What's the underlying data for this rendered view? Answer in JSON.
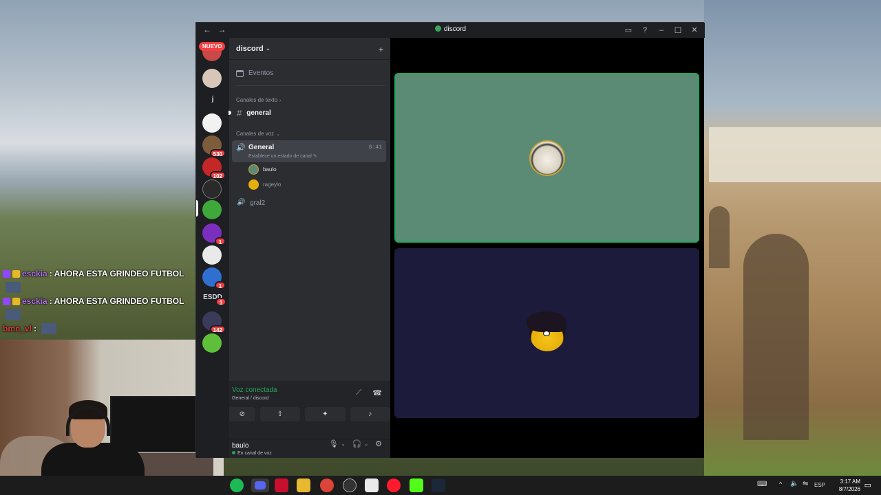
{
  "window": {
    "title": "discord",
    "nav_back": "←",
    "nav_forward": "→",
    "controls": {
      "inbox": "▭",
      "help": "?",
      "minimize": "–",
      "maximize": "☐",
      "close": "✕"
    }
  },
  "rail": {
    "nuevo_label": "NUEVO",
    "text_items": [
      {
        "label": "j"
      },
      {
        "label": "ESDD"
      }
    ],
    "badges": [
      "530",
      "102",
      "1",
      "1",
      "1",
      "142"
    ]
  },
  "server": {
    "name": "discord",
    "chevron": "⌄",
    "invite_icon": "+"
  },
  "sidebar": {
    "events_label": "Eventos",
    "text_category": "Canales de texto",
    "text_category_chev": "›",
    "text_channels": [
      {
        "name": "general"
      }
    ],
    "voice_category": "Canales de voz",
    "voice_category_chev": "⌄",
    "voice_channels": [
      {
        "name": "General",
        "status": "Establece un estado de canal ✎",
        "time": "6:41"
      },
      {
        "name": "gral2"
      }
    ],
    "members": [
      {
        "name": "baulo"
      },
      {
        "name": "rageylo"
      }
    ]
  },
  "voice_panel": {
    "status": "Voz conectada",
    "sub": "General / discord"
  },
  "user_panel": {
    "name": "baulo",
    "status": "En canal de voz"
  },
  "chat_overlay": {
    "lines": [
      {
        "user": "esckia",
        "text": ": AHORA ESTA GRINDEO FUTBOL"
      },
      {
        "user": "esckia",
        "text": ": AHORA ESTA GRINDEO FUTBOL"
      },
      {
        "user": "bmn_vl",
        "text": ":"
      }
    ]
  },
  "taskbar": {
    "lang": "ESP",
    "time": "3:17 AM",
    "date": "8/7/2026"
  },
  "colors": {
    "accent_green": "#23a55a",
    "tile_green": "#5b8b75",
    "tile_navy": "#1c1b3c",
    "badge_red": "#f23f42"
  }
}
